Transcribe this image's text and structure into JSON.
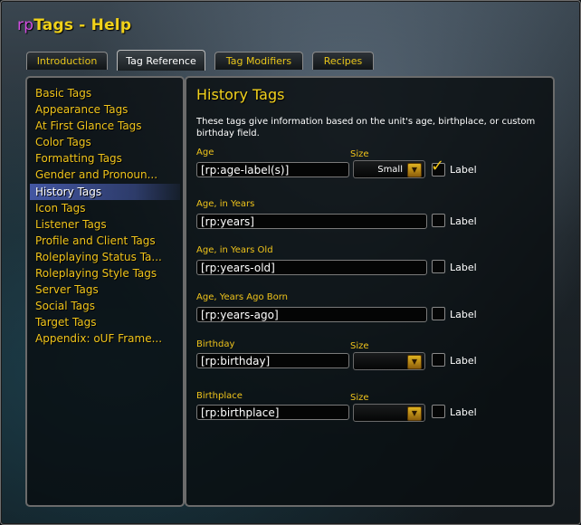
{
  "window": {
    "title_prefix": "rp",
    "title_main": "Tags - Help"
  },
  "tabs": [
    {
      "label": "Introduction",
      "active": false
    },
    {
      "label": "Tag Reference",
      "active": true
    },
    {
      "label": "Tag Modifiers",
      "active": false
    },
    {
      "label": "Recipes",
      "active": false
    }
  ],
  "sidebar": {
    "items": [
      {
        "label": "Basic Tags"
      },
      {
        "label": "Appearance Tags"
      },
      {
        "label": "At First Glance Tags"
      },
      {
        "label": "Color Tags"
      },
      {
        "label": "Formatting Tags"
      },
      {
        "label": "Gender and Pronoun..."
      },
      {
        "label": "History Tags",
        "selected": true
      },
      {
        "label": "Icon Tags"
      },
      {
        "label": "Listener Tags"
      },
      {
        "label": "Profile and Client Tags"
      },
      {
        "label": "Roleplaying Status Ta..."
      },
      {
        "label": "Roleplaying Style Tags"
      },
      {
        "label": "Server Tags"
      },
      {
        "label": "Social Tags"
      },
      {
        "label": "Target Tags"
      },
      {
        "label": "Appendix: oUF Frame..."
      }
    ]
  },
  "main": {
    "heading": "History Tags",
    "description": "These tags give information based on the unit's age, birthplace, or custom birthday field.",
    "fields": [
      {
        "label": "Age",
        "value": "[rp:age-label(s)]",
        "has_size": true,
        "size_label": "Size",
        "size_value": "Small",
        "label_checked": true,
        "checkbox_label": "Label"
      },
      {
        "label": "Age, in Years",
        "value": "[rp:years]",
        "has_size": false,
        "label_checked": false,
        "checkbox_label": "Label"
      },
      {
        "label": "Age, in Years Old",
        "value": "[rp:years-old]",
        "has_size": false,
        "label_checked": false,
        "checkbox_label": "Label"
      },
      {
        "label": "Age, Years Ago Born",
        "value": "[rp:years-ago]",
        "has_size": false,
        "label_checked": false,
        "checkbox_label": "Label"
      },
      {
        "label": "Birthday",
        "value": "[rp:birthday]",
        "has_size": true,
        "size_label": "Size",
        "size_value": "",
        "label_checked": false,
        "checkbox_label": "Label"
      },
      {
        "label": "Birthplace",
        "value": "[rp:birthplace]",
        "has_size": true,
        "size_label": "Size",
        "size_value": "",
        "label_checked": false,
        "checkbox_label": "Label"
      }
    ]
  },
  "icons": {
    "dropdown_arrow": "chevron-down-icon",
    "checkmark": "check-icon"
  },
  "colors": {
    "accent_gold": "#f0c41b",
    "title_magenta": "#d14de0",
    "selection_blue": "#4a5aaa"
  }
}
